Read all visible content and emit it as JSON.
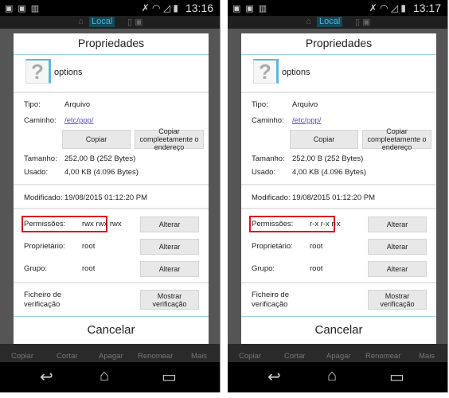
{
  "screens": [
    {
      "time": "13:16",
      "location": "Local",
      "dialog": {
        "title": "Propriedades",
        "file_name": "options",
        "type_label": "Tipo:",
        "type_value": "Arquivo",
        "path_label": "Caminho:",
        "path_value": "/etc/ppp/",
        "copy_button": "Copiar",
        "copy_full_button": "Copiar compleetamente o endereço",
        "size_label": "Tamanho:",
        "size_value": "252,00 B (252 Bytes)",
        "used_label": "Usado:",
        "used_value": "4,00 KB (4.096 Bytes)",
        "modified_label": "Modificado:",
        "modified_value": "19/08/2015 01:12:20 PM",
        "permissions_label": "Permissões:",
        "permissions_value": "rwx rwx rwx",
        "change_button": "Alterar",
        "owner_label": "Proprietário:",
        "owner_value": "root",
        "group_label": "Grupo:",
        "group_value": "root",
        "checksum_label": "Ficheiro de verificação",
        "checksum_button": "Mostrar verificação",
        "cancel": "Cancelar"
      },
      "actions": [
        "Copiar",
        "Cortar",
        "Apagar",
        "Renomear",
        "Mais"
      ]
    },
    {
      "time": "13:17",
      "location": "Local",
      "dialog": {
        "title": "Propriedades",
        "file_name": "options",
        "type_label": "Tipo:",
        "type_value": "Arquivo",
        "path_label": "Caminho:",
        "path_value": "/etc/ppp/",
        "copy_button": "Copiar",
        "copy_full_button": "Copiar compleetamente o endereço",
        "size_label": "Tamanho:",
        "size_value": "252,00 B (252 Bytes)",
        "used_label": "Usado:",
        "used_value": "4,00 KB (4.096 Bytes)",
        "modified_label": "Modificado:",
        "modified_value": "19/08/2015 01:12:20 PM",
        "permissions_label": "Permissões:",
        "permissions_value": "r-x r-x r-x",
        "change_button": "Alterar",
        "owner_label": "Proprietário:",
        "owner_value": "root",
        "group_label": "Grupo:",
        "group_value": "root",
        "checksum_label": "Ficheiro de verificação",
        "checksum_button": "Mostrar verificação",
        "cancel": "Cancelar"
      },
      "actions": [
        "Copiar",
        "Cortar",
        "Apagar",
        "Renomear",
        "Mais"
      ]
    }
  ],
  "colors": {
    "highlight": "#e0141e",
    "accent": "#5bb7de",
    "link": "#5a4fc9"
  },
  "icons": [
    "gallery-icon",
    "clipboard-check-icon",
    "barcode-icon",
    "mute-icon",
    "wifi-icon",
    "signal-icon",
    "battery-icon",
    "home-icon",
    "device-icon",
    "question-file-icon",
    "back-icon",
    "home-nav-icon",
    "recent-apps-icon"
  ]
}
